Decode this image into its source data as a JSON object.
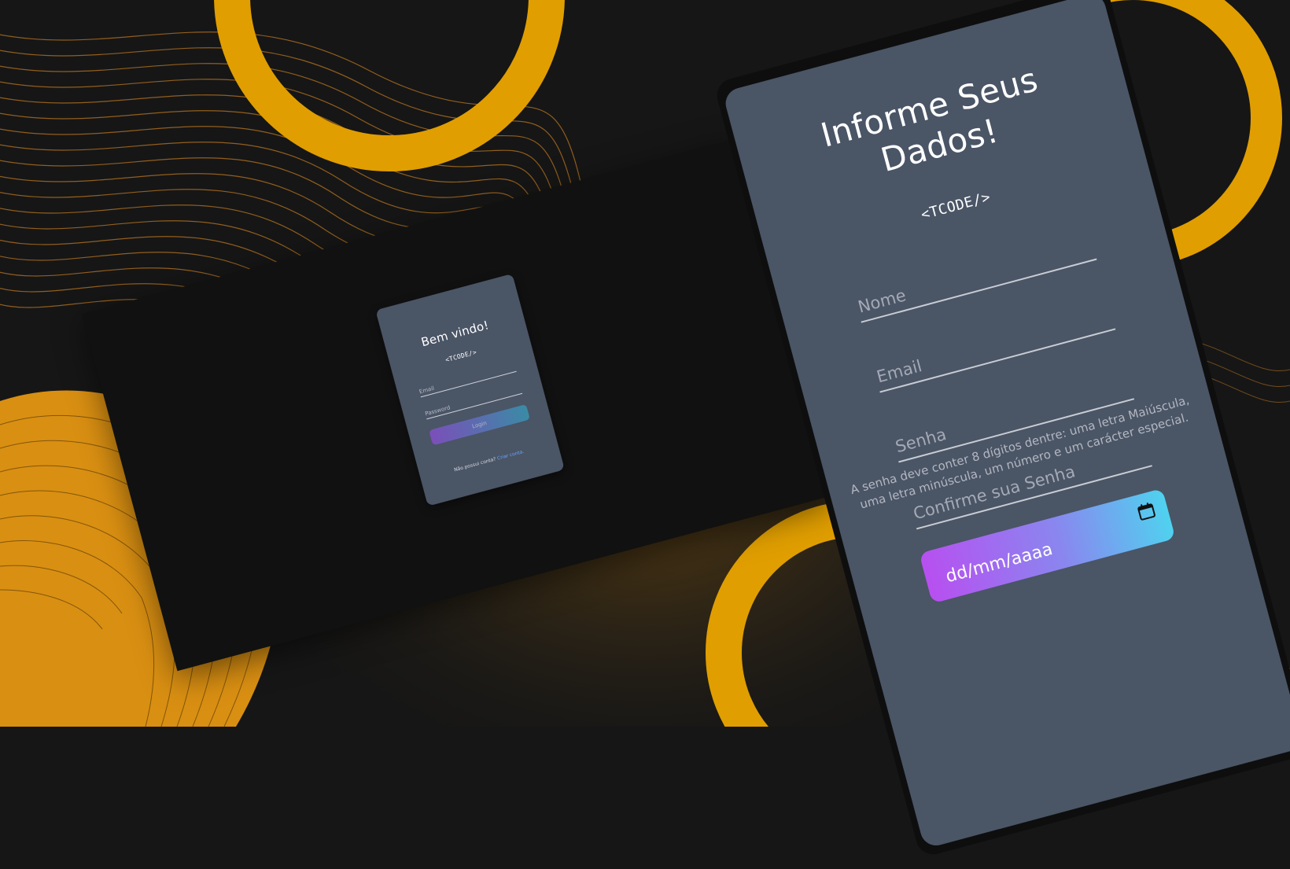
{
  "login": {
    "title": "Bem vindo!",
    "logo": "<TCODE/>",
    "email_placeholder": "Email",
    "password_placeholder": "Password",
    "button_label": "Login",
    "footer_text": "Não possui conta?",
    "footer_link": "Criar conta."
  },
  "register": {
    "title_line1": "Informe Seus",
    "title_line2": "Dados!",
    "logo": "<TCODE/>",
    "name_placeholder": "Nome",
    "email_placeholder": "Email",
    "password_placeholder": "Senha",
    "password_hint_line1": "A senha deve conter 8 dígitos dentre: uma letra Maiúscula,",
    "password_hint_line2": "uma letra minúscula, um número e um carácter especial.",
    "confirm_placeholder": "Confirme sua Senha",
    "date_placeholder": "dd/mm/aaaa",
    "calendar_icon": "calendar-icon"
  },
  "colors": {
    "accent_yellow": "#e09e00",
    "card_bg": "#4a5566",
    "dark_bg": "#111111"
  }
}
